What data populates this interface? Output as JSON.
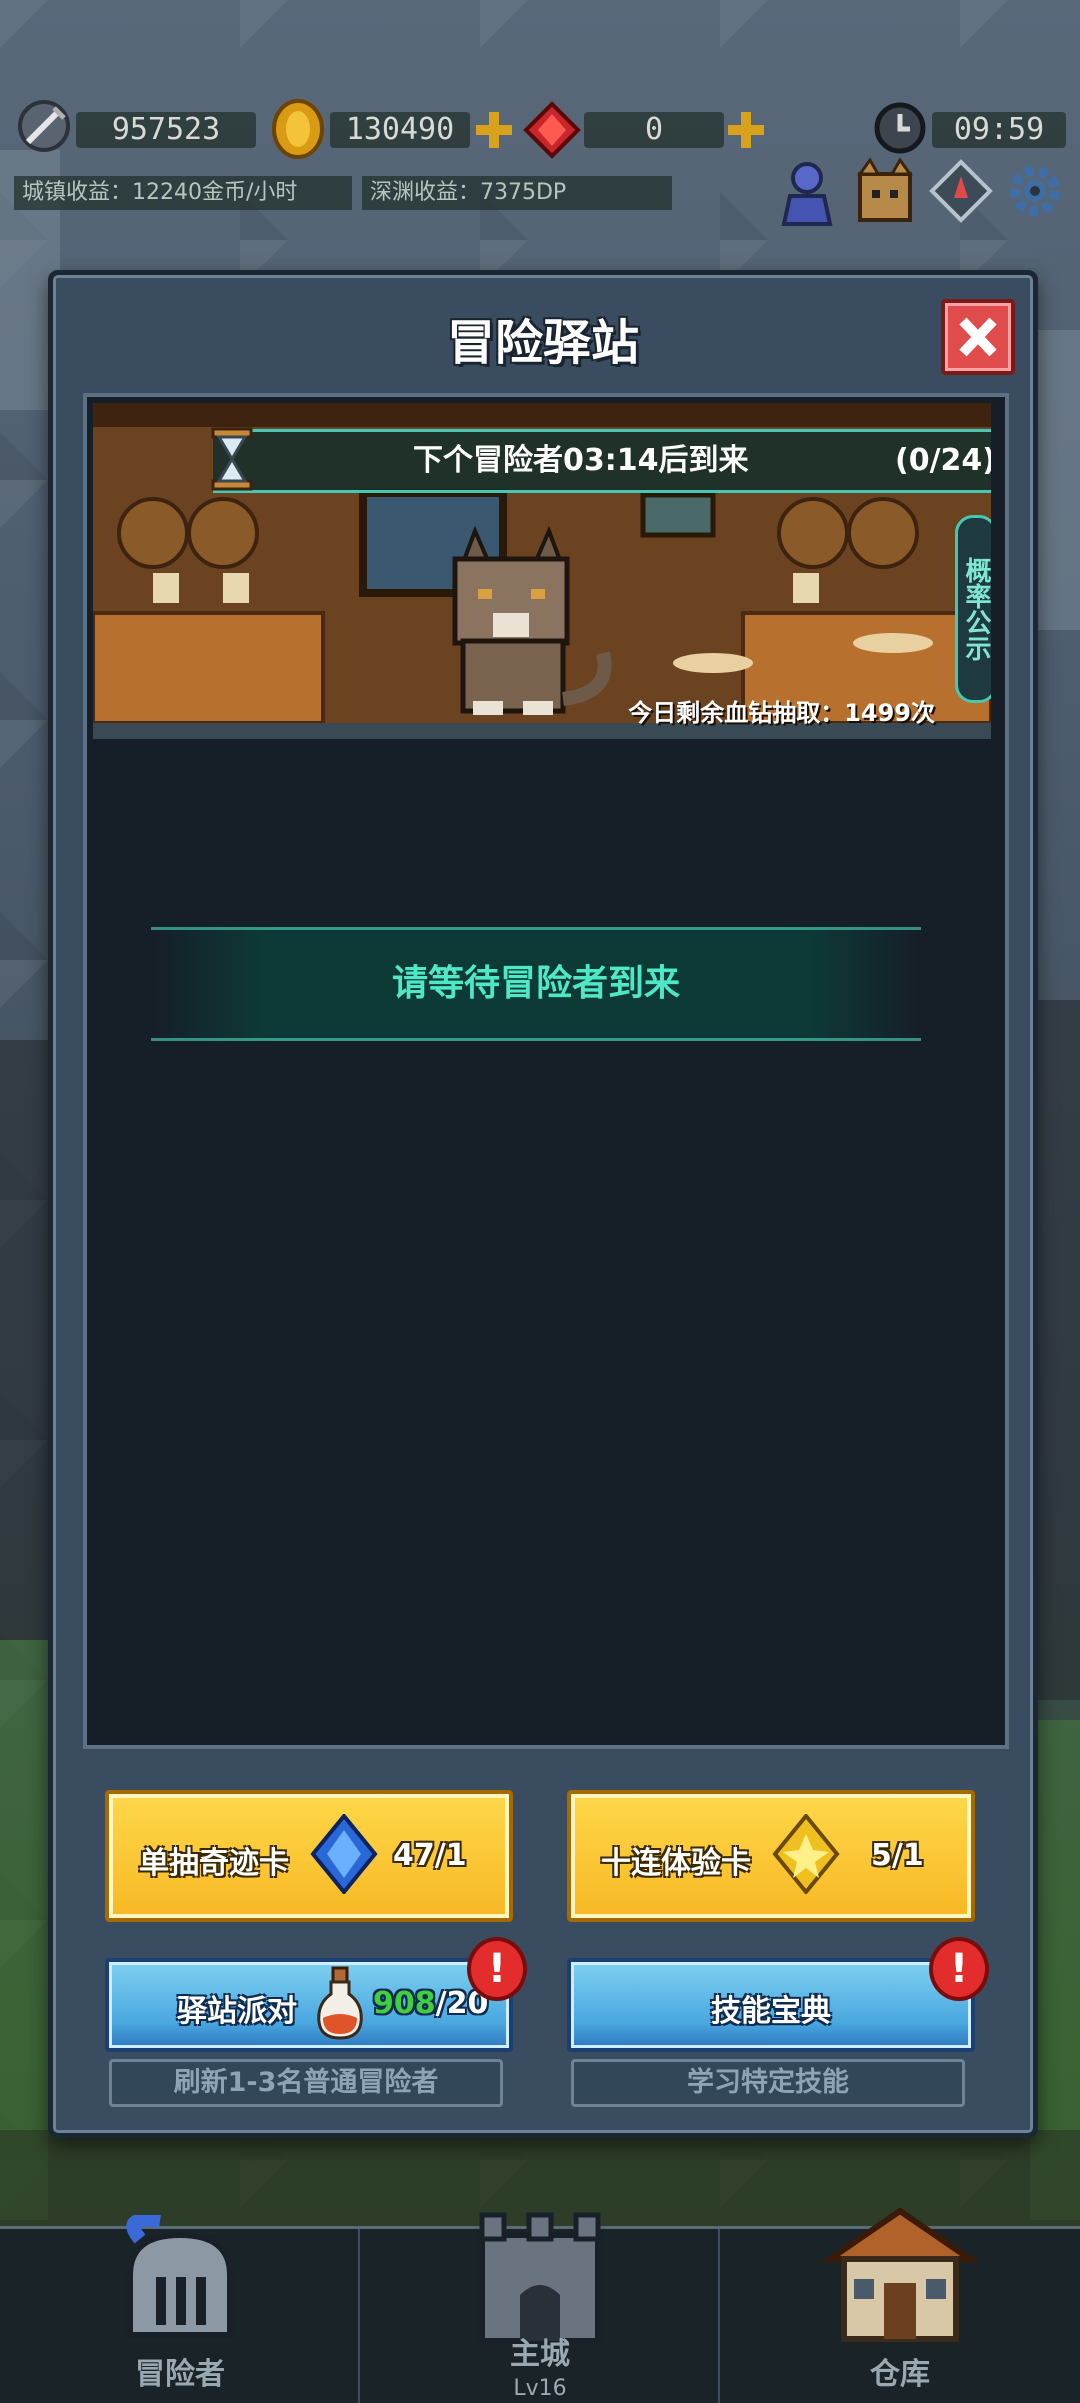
{
  "hud": {
    "power": "957523",
    "gold": "130490",
    "gems": "0",
    "time": "09:59",
    "town_income": "城镇收益：12240金币/小时",
    "abyss_income": "深渊收益：7375DP"
  },
  "modal": {
    "title": "冒险驿站",
    "timer_text": "下个冒险者03:14后到来",
    "timer_count": "(0/24)",
    "probability_tab": "概率公示",
    "remaining_draws": "今日剩余血钻抽取：1499次",
    "waiting_text": "请等待冒险者到来"
  },
  "buttons": {
    "single_draw_label": "单抽奇迹卡",
    "single_draw_count": "47/1",
    "ten_draw_label": "十连体验卡",
    "ten_draw_count": "5/1",
    "party_label": "驿站派对",
    "party_count_current": "908",
    "party_count_total": "/20",
    "skill_label": "技能宝典",
    "party_desc": "刷新1-3名普通冒险者",
    "skill_desc": "学习特定技能",
    "alert_mark": "!"
  },
  "nav": {
    "items": [
      {
        "label": "冒险者"
      },
      {
        "label": "主城",
        "sub": "Lv16"
      },
      {
        "label": "仓库"
      }
    ]
  },
  "colors": {
    "accent_teal": "#4ee8c6",
    "button_yellow": "#ffd84a",
    "button_blue": "#4aa8e0",
    "alert_red": "#e32d2d",
    "party_green": "#3fcf3f"
  },
  "icons": [
    "power-icon",
    "gold-coin-icon",
    "plus-icon",
    "gem-icon",
    "clock-icon",
    "adventurer-icon",
    "cat-helmet-icon",
    "compass-icon",
    "gear-icon",
    "close-icon",
    "hourglass-icon",
    "blue-card-icon",
    "gold-card-icon",
    "potion-icon",
    "helmet-icon",
    "castle-icon",
    "warehouse-icon"
  ]
}
